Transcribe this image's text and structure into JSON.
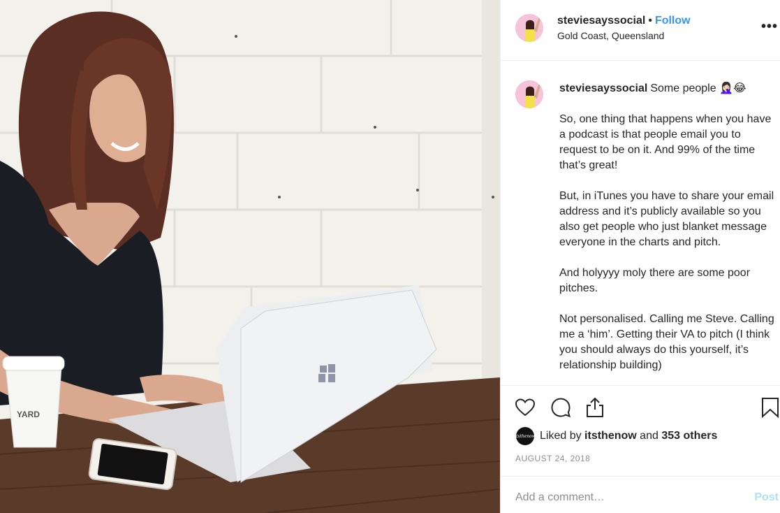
{
  "post": {
    "username": "steviesayssocial",
    "separator": "•",
    "follow_label": "Follow",
    "location": "Gold Coast, Queensland",
    "more_label": "•••"
  },
  "caption": {
    "username": "steviesayssocial",
    "first_line": "Some people 🤦🏻‍♀️😂",
    "paragraphs": [
      "So, one thing that happens when you have a podcast is that people email you to request to be on it. And 99% of the time that’s great!",
      "But, in iTunes you have to share your email address and it’s publicly available so you also get people who just blanket message everyone in the charts and pitch.",
      "And holyyyy moly there are some poor pitches.",
      "Not personalised. Calling me Steve. Calling me a ‘him’. Getting their VA to pitch (I think you should always do this yourself, it’s relationship building)"
    ]
  },
  "photo": {
    "cup_logo": "YARD"
  },
  "likes": {
    "prefix": "Liked by",
    "user": "itsthenow",
    "conjunction": "and",
    "others": "353 others",
    "avatar_text": "itsthenow"
  },
  "date": "AUGUST 24, 2018",
  "comment_box": {
    "placeholder": "Add a comment…",
    "post_label": "Post"
  },
  "icons": {
    "like": "heart-icon",
    "comment": "speech-bubble-icon",
    "share": "share-icon",
    "save": "bookmark-icon",
    "more": "ellipsis-icon"
  },
  "colors": {
    "link_blue": "#3897f0",
    "post_disabled": "#b2dffc",
    "muted_text": "#8e8e8e",
    "divider": "#efefef"
  }
}
